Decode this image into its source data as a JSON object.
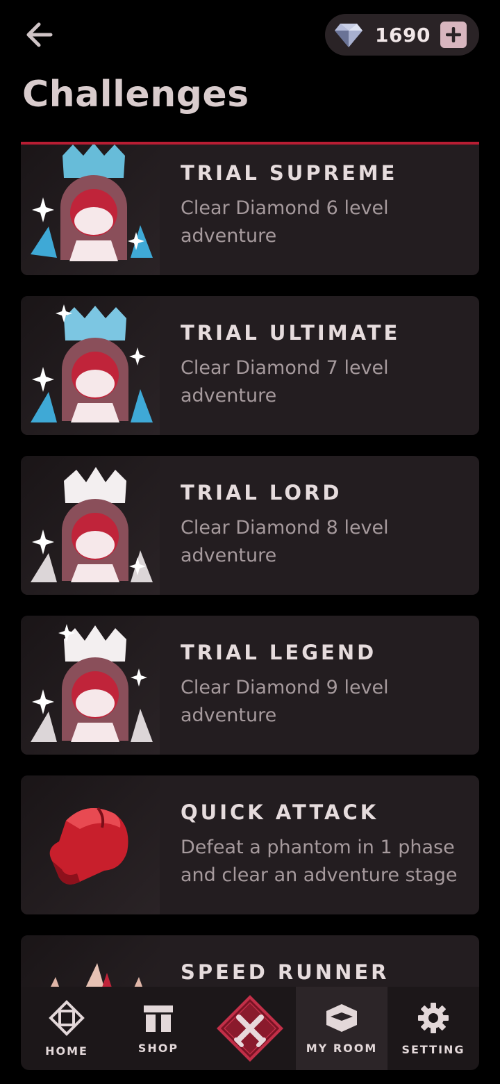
{
  "header": {
    "title": "Challenges",
    "gem_count": "1690"
  },
  "challenges": [
    {
      "title": "TRIAL SUPREME",
      "desc": "Clear Diamond 6 level adventure",
      "icon": "blue-crown-girl-icon"
    },
    {
      "title": "TRIAL ULTIMATE",
      "desc": "Clear Diamond 7 level adventure",
      "icon": "blue-crown-girl-sparkle-icon"
    },
    {
      "title": "TRIAL LORD",
      "desc": "Clear Diamond 8 level adventure",
      "icon": "white-crown-girl-icon"
    },
    {
      "title": "TRIAL LEGEND",
      "desc": "Clear Diamond 9 level adventure",
      "icon": "white-crown-girl-sparkle-icon"
    },
    {
      "title": "QUICK ATTACK",
      "desc": "Defeat a phantom in 1 phase and clear an adventure stage",
      "icon": "boxing-glove-icon"
    },
    {
      "title": "SPEED RUNNER",
      "desc": "",
      "icon": "flame-spikes-icon"
    }
  ],
  "nav": {
    "home": "HOME",
    "shop": "SHOP",
    "my_room": "MY ROOM",
    "setting": "SETTING"
  },
  "colors": {
    "accent": "#b81d33",
    "card_bg": "#231d20",
    "background": "#000000"
  }
}
